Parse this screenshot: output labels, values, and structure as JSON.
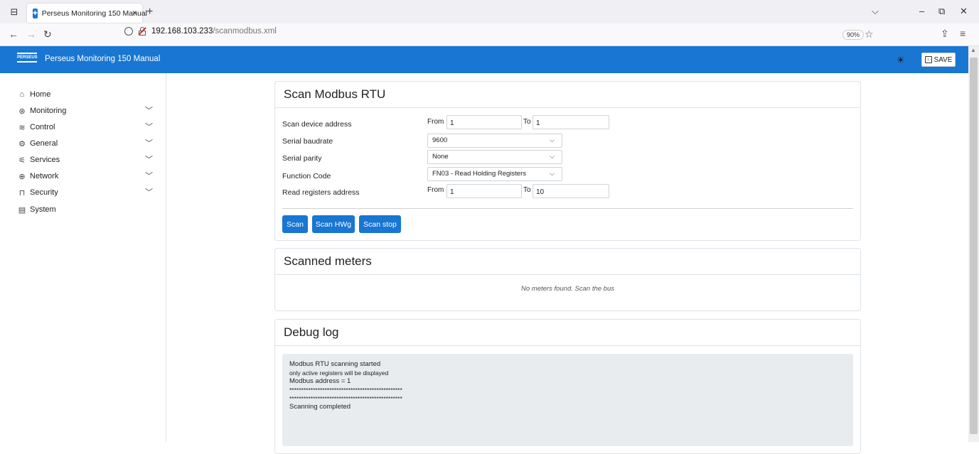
{
  "browser": {
    "tab_title": "Perseus Monitoring 150 Manual",
    "tab_close": "×",
    "new_tab": "+",
    "url_host": "192.168.103.233",
    "url_path": "/scanmodbus.xml",
    "zoom": "90%"
  },
  "app": {
    "logo_text": "PERSEUS",
    "title": "Perseus Monitoring 150 Manual",
    "save_label": "SAVE"
  },
  "sidebar": {
    "items": [
      {
        "label": "Home",
        "icon": "home-icon",
        "glyph": "⌂",
        "has_children": false
      },
      {
        "label": "Monitoring",
        "icon": "gauge-icon",
        "glyph": "⊛",
        "has_children": true
      },
      {
        "label": "Control",
        "icon": "sliders-icon",
        "glyph": "≋",
        "has_children": true
      },
      {
        "label": "General",
        "icon": "gear-icon",
        "glyph": "⚙",
        "has_children": true
      },
      {
        "label": "Services",
        "icon": "services-icon",
        "glyph": "⚟",
        "has_children": true
      },
      {
        "label": "Network",
        "icon": "globe-icon",
        "glyph": "⊕",
        "has_children": true
      },
      {
        "label": "Security",
        "icon": "lock-icon",
        "glyph": "⊓",
        "has_children": true
      },
      {
        "label": "System",
        "icon": "system-icon",
        "glyph": "▤",
        "has_children": false
      }
    ]
  },
  "scan_card": {
    "title": "Scan Modbus RTU",
    "device_address_label": "Scan device address",
    "from_label": "From",
    "to_label": "To",
    "device_from": "1",
    "device_to": "1",
    "baudrate_label": "Serial baudrate",
    "baudrate_value": "9600",
    "parity_label": "Serial parity",
    "parity_value": "None",
    "function_label": "Function Code",
    "function_value": "FN03 - Read Holding Registers",
    "registers_label": "Read registers address",
    "registers_from": "1",
    "registers_to": "10",
    "btn_scan": "Scan",
    "btn_scan_hwg": "Scan HWg",
    "btn_scan_stop": "Scan stop"
  },
  "meters_card": {
    "title": "Scanned meters",
    "empty_message": "No meters found. Scan the bus"
  },
  "debug_card": {
    "title": "Debug log",
    "lines": [
      "Modbus RTU scanning started",
      "only active registers will be displayed",
      "Modbus address = 1",
      "************************************************",
      "************************************************",
      "Scanning completed"
    ]
  },
  "colors": {
    "header_bg": "#1976d2",
    "button_bg": "#1976d2",
    "log_bg": "#e9ecef"
  }
}
